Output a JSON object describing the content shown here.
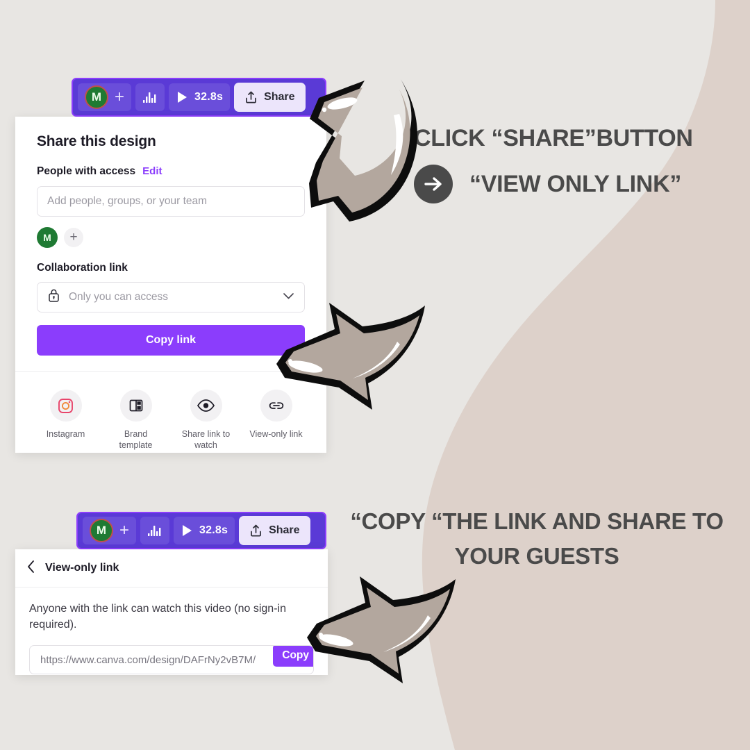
{
  "theme": {
    "background": "#e8e6e3",
    "blob": "#ddd1ca",
    "canva_purple": "#8b3dfc",
    "toolbar_purple": "#5a3ad6",
    "arrow_fill": "#b3a79e",
    "arrow_outline": "#0d0d0d",
    "text_dark": "#4a4a4a"
  },
  "toolbar": {
    "avatar_initial": "M",
    "add_label": "+",
    "chart_icon": "bar-chart-icon",
    "play_icon": "play-icon",
    "duration": "32.8s",
    "share_icon": "upload-share-icon",
    "share_label": "Share"
  },
  "share_panel": {
    "title": "Share this design",
    "people_label": "People with access",
    "edit_label": "Edit",
    "people_input_placeholder": "Add people, groups, or your team",
    "member_initial": "M",
    "member_add_label": "+",
    "collab_label": "Collaboration link",
    "access_icon": "lock-icon",
    "access_value": "Only you can access",
    "access_chevron": "chevron-down-icon",
    "copy_link_label": "Copy link",
    "options": [
      {
        "icon": "instagram-icon",
        "label": "Instagram"
      },
      {
        "icon": "brand-template-icon",
        "label": "Brand\ntemplate"
      },
      {
        "icon": "eye-icon",
        "label": "Share link to\nwatch"
      },
      {
        "icon": "link-icon",
        "label": "View-only link"
      }
    ]
  },
  "view_only_panel": {
    "back_icon": "chevron-left-icon",
    "title": "View-only link",
    "description": "Anyone with the link can watch this video (no sign-in required).",
    "url": "https://www.canva.com/design/DAFrNy2vB7M/",
    "copy_label": "Copy"
  },
  "instructions": {
    "step1_line1": "CLICK “SHARE”BUTTON",
    "step1_icon": "arrow-right-circle-icon",
    "step1_line2": "“VIEW ONLY LINK”",
    "step2_line1": "“COPY “THE LINK AND SHARE TO",
    "step2_line2": "YOUR GUESTS"
  }
}
